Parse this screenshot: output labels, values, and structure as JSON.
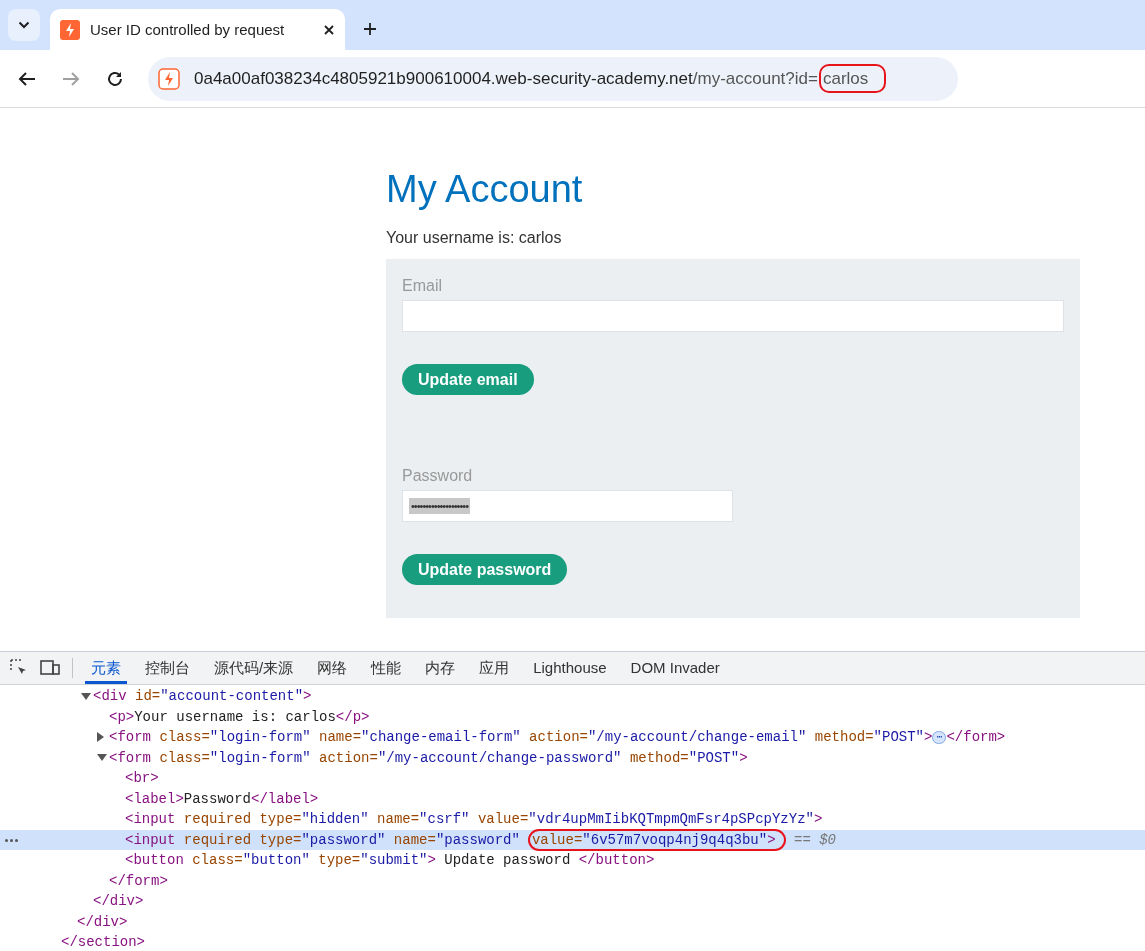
{
  "browser": {
    "tab": {
      "title": "User ID controlled by request",
      "selected": true
    },
    "address": [
      {
        "kind": "host",
        "text": "0a4a00af038234c4805921b900610004.web-security-academy.net"
      },
      {
        "kind": "path",
        "text": "/my-account?id="
      },
      {
        "kind": "circled",
        "parts": [
          {
            "kind": "path",
            "text": "carlos"
          }
        ]
      }
    ],
    "forward_disabled": true
  },
  "page": {
    "title": "My Account",
    "username_text": "Your username is: carlos",
    "email": {
      "label": "Email"
    },
    "email_button": "Update email",
    "password": {
      "label": "Password",
      "value": "••••••••••••••••••••"
    },
    "password_button": "Update password"
  },
  "devtools": {
    "tabs": [
      {
        "label": "元素",
        "selected": true
      },
      {
        "label": "控制台",
        "selected": false
      },
      {
        "label": "源代码/来源",
        "selected": false
      },
      {
        "label": "网络",
        "selected": false
      },
      {
        "label": "性能",
        "selected": false
      },
      {
        "label": "内存",
        "selected": false
      },
      {
        "label": "应用",
        "selected": false
      },
      {
        "label": "Lighthouse",
        "selected": false
      },
      {
        "label": "DOM Invader",
        "selected": false
      }
    ],
    "tree": [
      {
        "close": [
          {
            "kind": "tag",
            "text": "</section>"
          }
        ],
        "children": [
          {
            "close": [
              {
                "kind": "tag",
                "text": "</div>"
              }
            ],
            "children": [
              {
                "expanded": true,
                "selected": false,
                "parts": [
                  {
                    "kind": "tag",
                    "text": "<div"
                  },
                  {
                    "kind": "attr",
                    "text": " id="
                  },
                  {
                    "kind": "value",
                    "text": "\"account-content\""
                  },
                  {
                    "kind": "tag",
                    "text": ">"
                  }
                ],
                "close": [
                  {
                    "kind": "tag",
                    "text": "</div>"
                  }
                ],
                "children": [
                  {
                    "selected": false,
                    "parts": [
                      {
                        "kind": "tag",
                        "text": "<p>"
                      },
                      {
                        "kind": "text",
                        "text": "Your username is: carlos"
                      },
                      {
                        "kind": "tag",
                        "text": "</p>"
                      }
                    ]
                  },
                  {
                    "expanded": false,
                    "selected": false,
                    "parts": [
                      {
                        "kind": "tag",
                        "text": "<form"
                      },
                      {
                        "kind": "attr",
                        "text": " class="
                      },
                      {
                        "kind": "value",
                        "text": "\"login-form\""
                      },
                      {
                        "kind": "attr",
                        "text": " name="
                      },
                      {
                        "kind": "value",
                        "text": "\"change-email-form\""
                      },
                      {
                        "kind": "attr",
                        "text": " action="
                      },
                      {
                        "kind": "value",
                        "text": "\"/my-account/change-email\""
                      },
                      {
                        "kind": "attr",
                        "text": " method="
                      },
                      {
                        "kind": "value",
                        "text": "\"POST\""
                      },
                      {
                        "kind": "tag",
                        "text": ">"
                      },
                      {
                        "kind": "badge",
                        "text": "⋯"
                      },
                      {
                        "kind": "tag",
                        "text": "</form>"
                      }
                    ]
                  },
                  {
                    "expanded": true,
                    "selected": false,
                    "parts": [
                      {
                        "kind": "tag",
                        "text": "<form"
                      },
                      {
                        "kind": "attr",
                        "text": " class="
                      },
                      {
                        "kind": "value",
                        "text": "\"login-form\""
                      },
                      {
                        "kind": "attr",
                        "text": " action="
                      },
                      {
                        "kind": "value",
                        "text": "\"/my-account/change-password\""
                      },
                      {
                        "kind": "attr",
                        "text": " method="
                      },
                      {
                        "kind": "value",
                        "text": "\"POST\""
                      },
                      {
                        "kind": "tag",
                        "text": ">"
                      }
                    ],
                    "close": [
                      {
                        "kind": "tag",
                        "text": "</form>"
                      }
                    ],
                    "children": [
                      {
                        "selected": false,
                        "parts": [
                          {
                            "kind": "tag",
                            "text": "<br>"
                          }
                        ]
                      },
                      {
                        "selected": false,
                        "parts": [
                          {
                            "kind": "tag",
                            "text": "<label>"
                          },
                          {
                            "kind": "text",
                            "text": "Password"
                          },
                          {
                            "kind": "tag",
                            "text": "</label>"
                          }
                        ]
                      },
                      {
                        "selected": false,
                        "parts": [
                          {
                            "kind": "tag",
                            "text": "<input"
                          },
                          {
                            "kind": "attr",
                            "text": " required type="
                          },
                          {
                            "kind": "value",
                            "text": "\"hidden\""
                          },
                          {
                            "kind": "attr",
                            "text": " name="
                          },
                          {
                            "kind": "value",
                            "text": "\"csrf\""
                          },
                          {
                            "kind": "attr",
                            "text": " value="
                          },
                          {
                            "kind": "value",
                            "text": "\"vdr4upMmIibKQTmpmQmFsr4pSPcpYzYz\""
                          },
                          {
                            "kind": "tag",
                            "text": ">"
                          }
                        ]
                      },
                      {
                        "selected": true,
                        "parts": [
                          {
                            "kind": "tag",
                            "text": "<input"
                          },
                          {
                            "kind": "attr",
                            "text": " required type="
                          },
                          {
                            "kind": "value",
                            "text": "\"password\""
                          },
                          {
                            "kind": "attr",
                            "text": " name="
                          },
                          {
                            "kind": "value",
                            "text": "\"password\""
                          },
                          {
                            "kind": "circled",
                            "parts": [
                              {
                                "kind": "attr",
                                "text": "value="
                              },
                              {
                                "kind": "value",
                                "text": "\"6v57m7voqp4nj9q4q3bu\""
                              },
                              {
                                "kind": "tag",
                                "text": ">"
                              }
                            ]
                          },
                          {
                            "kind": "hint",
                            "text": " == $0"
                          }
                        ]
                      },
                      {
                        "selected": false,
                        "parts": [
                          {
                            "kind": "tag",
                            "text": "<button"
                          },
                          {
                            "kind": "attr",
                            "text": " class="
                          },
                          {
                            "kind": "value",
                            "text": "\"button\""
                          },
                          {
                            "kind": "attr",
                            "text": " type="
                          },
                          {
                            "kind": "value",
                            "text": "\"submit\""
                          },
                          {
                            "kind": "tag",
                            "text": ">"
                          },
                          {
                            "kind": "text",
                            "text": " Update password "
                          },
                          {
                            "kind": "tag",
                            "text": "</button>"
                          }
                        ]
                      }
                    ]
                  }
                ]
              }
            ]
          }
        ]
      }
    ]
  }
}
